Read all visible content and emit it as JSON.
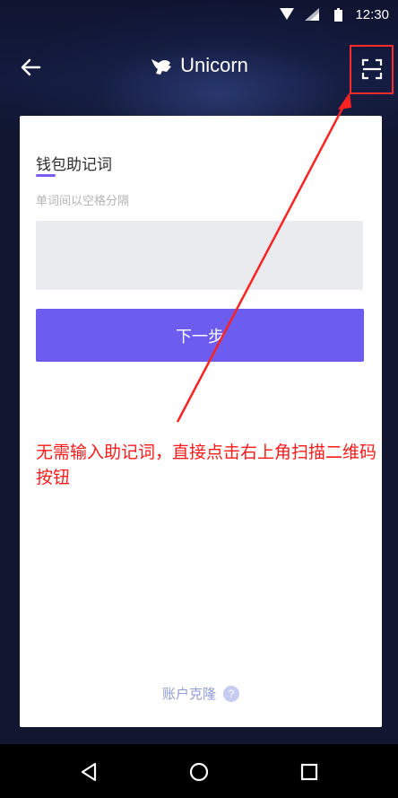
{
  "status": {
    "time": "12:30"
  },
  "header": {
    "title": "Unicorn"
  },
  "form": {
    "section_title": "钱包助记词",
    "hint": "单词间以空格分隔",
    "mnemonic_value": "",
    "next_label": "下一步"
  },
  "footer": {
    "clone_label": "账户克隆",
    "help_glyph": "?"
  },
  "annotation": {
    "text": "无需输入助记词，直接点击右上角扫描二维码按钮"
  },
  "colors": {
    "accent": "#6c5df0",
    "annotation_red": "#ff1a1a",
    "background_dark": "#121731"
  }
}
